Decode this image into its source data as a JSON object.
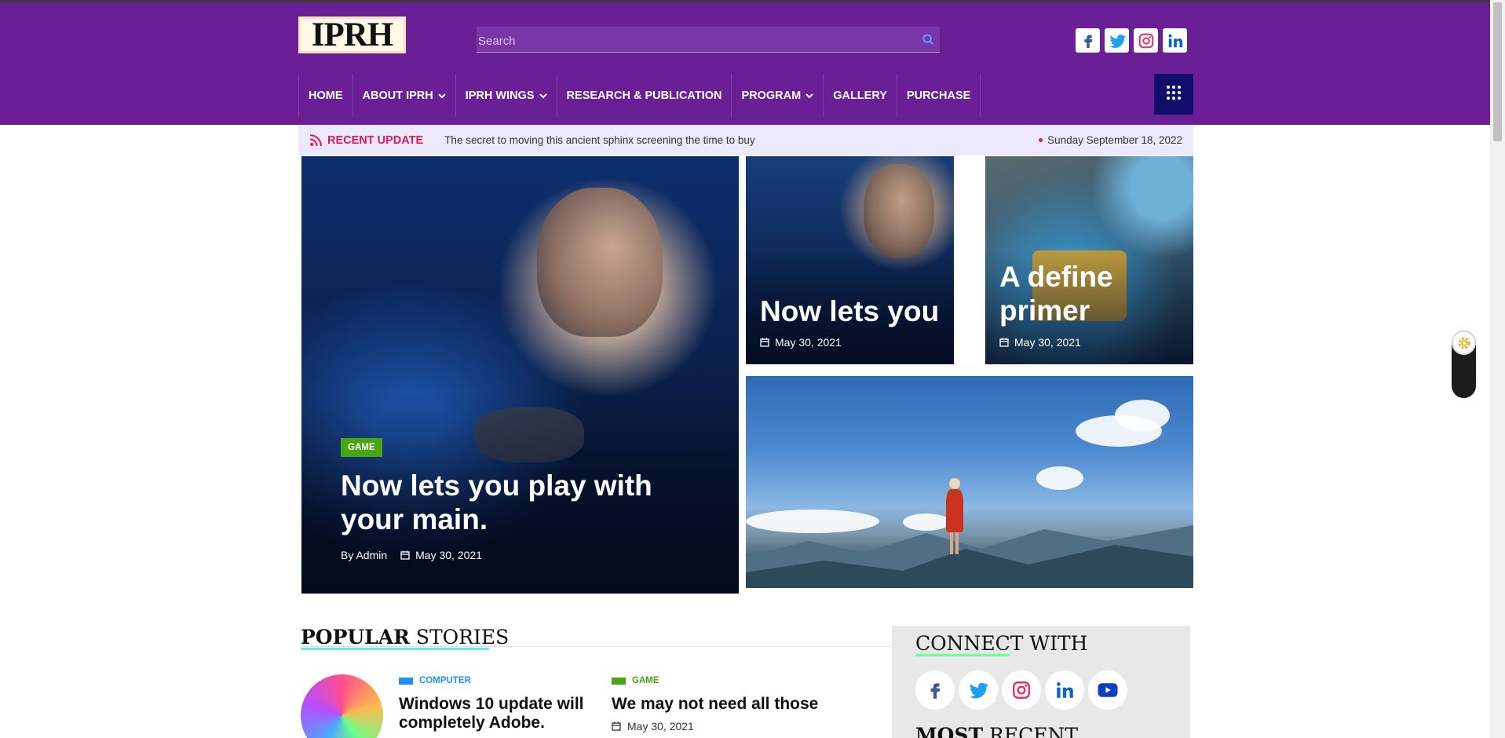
{
  "header": {
    "logo_text": "IPRH",
    "search_placeholder": "Search",
    "social": [
      "facebook-icon",
      "twitter-icon",
      "instagram-icon",
      "linkedin-icon"
    ]
  },
  "nav": {
    "items": [
      {
        "label": "HOME",
        "dropdown": false
      },
      {
        "label": "ABOUT IPRH",
        "dropdown": true
      },
      {
        "label": "IPRH WINGS",
        "dropdown": true
      },
      {
        "label": "RESEARCH & PUBLICATION",
        "dropdown": false
      },
      {
        "label": "PROGRAM",
        "dropdown": true
      },
      {
        "label": "GALLERY",
        "dropdown": false
      },
      {
        "label": "PURCHASE",
        "dropdown": false
      }
    ]
  },
  "ticker": {
    "label": "RECENT UPDATE",
    "text": "The secret to moving this ancient sphinx screening the time to buy",
    "date": "Sunday September 18, 2022"
  },
  "featured": {
    "main": {
      "badge": "GAME",
      "title": "Now lets you play with your main.",
      "author": "By Admin",
      "date": "May 30, 2021"
    },
    "card2": {
      "title": "Now lets you",
      "date": "May 30, 2021"
    },
    "card3": {
      "title": "A define primer",
      "date": "May 30, 2021"
    }
  },
  "popular": {
    "heading_bold": "POPULAR",
    "heading_rest": " STORIES",
    "stories": [
      {
        "category": "COMPUTER",
        "category_color": "#1e90ff",
        "title": "Windows 10 update will completely Adobe."
      },
      {
        "category": "GAME",
        "category_color": "#4aa513",
        "title": "We may not need all those",
        "date": "May 30, 2021"
      }
    ]
  },
  "sidebar": {
    "connect_heading": "CONNECT WITH",
    "recent_bold": "MOST",
    "recent_rest": " RECENT",
    "social": [
      "facebook-icon",
      "twitter-icon",
      "instagram-icon",
      "linkedin-icon",
      "youtube-icon"
    ]
  },
  "colors": {
    "header_bg": "#6a1f97",
    "nav_grid_btn": "#110d6b",
    "accent_red": "#e5194f",
    "badge_green": "#4aa513"
  }
}
